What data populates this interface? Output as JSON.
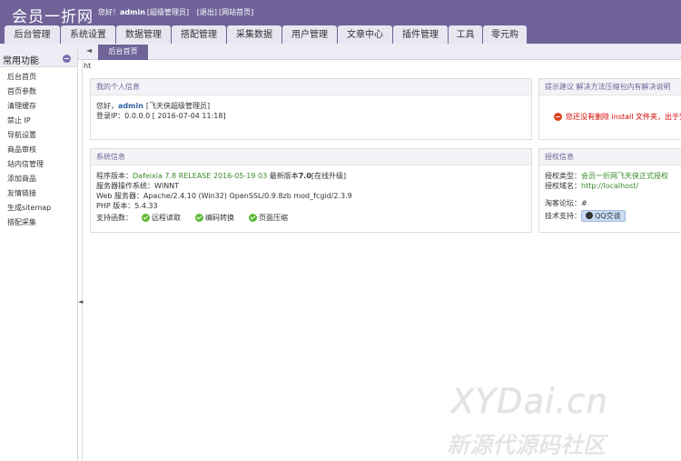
{
  "header": {
    "logo": "会员一折网",
    "greeting": "您好！",
    "user": "admin",
    "role": "[超级管理员]",
    "logout": "[退出]",
    "site_home": "[网站首页]"
  },
  "nav": [
    "后台管理",
    "系统设置",
    "数据管理",
    "搭配管理",
    "采集数据",
    "用户管理",
    "文章中心",
    "插件管理",
    "工具",
    "零元购"
  ],
  "tabbar": {
    "arrow": "◄",
    "active_tab": "后台首页"
  },
  "sidebar": {
    "title": "常用功能",
    "items": [
      "后台首页",
      "首页参数",
      "清理缓存",
      "禁止 IP",
      "导航设置",
      "商品审核",
      "站内信管理",
      "添加商品",
      "友情链接",
      "生成sitemap",
      "搭配采集"
    ]
  },
  "split_arrow": "◄",
  "ht": "ht",
  "profile": {
    "title": "我的个人信息",
    "hello": "您好，",
    "user": "admin",
    "role": "[飞天侠超级管理员]",
    "login_ip": "登录IP：0.0.0.0 [ 2016-07-04 11:18]"
  },
  "suggest": {
    "title": "提示建议 解决方法压缩包内有解决说明",
    "warning": "您还没有删除 install 文件夹，出于安"
  },
  "system": {
    "title": "系统信息",
    "version_label": "程序版本：",
    "version_value": "Dafeixia 7.8 RELEASE 2016-05-19 03",
    "latest_label": " 最新版本",
    "latest_version": "7.0",
    "upgrade": "[在线升级]",
    "os": "服务器操作系统：WINNT",
    "web": "Web 服务器：Apache/2.4.10 (Win32) OpenSSL/0.9.8zb mod_fcgid/2.3.9",
    "php": "PHP 版本：5.4.33",
    "support_label": "支持函数：",
    "functions": [
      "远程读取",
      "编码转换",
      "页面压缩"
    ]
  },
  "auth": {
    "title": "授权信息",
    "type_label": "授权类型：",
    "type_value": "会员一折网飞天侠正式授权",
    "domain_label": "授权域名：",
    "domain_value": "http://localhost/",
    "forum_label": "淘客论坛：",
    "forum_value": "#",
    "support_label": "技术支持：",
    "qq": "QQ交谈"
  },
  "watermark": {
    "line1": "XYDai.cn",
    "line2": "新源代源码社区"
  }
}
